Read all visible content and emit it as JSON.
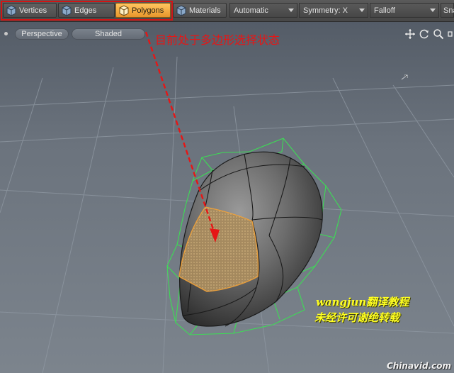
{
  "toolbar": {
    "modes": [
      {
        "label": "Vertices",
        "active": false
      },
      {
        "label": "Edges",
        "active": false
      },
      {
        "label": "Polygons",
        "active": true
      },
      {
        "label": "Materials",
        "active": false
      }
    ],
    "action_center": "Automatic",
    "symmetry": "Symmetry: X",
    "falloff": "Falloff",
    "snap": "Sna"
  },
  "viewport": {
    "view": "Perspective",
    "shading": "Shaded"
  },
  "annotations": {
    "red_note": "目前处于多边形选择状态",
    "credit_line1": "wangjun翻译教程",
    "credit_line2": "未经许可谢绝转载",
    "watermark": "Chinavid.com"
  },
  "colors": {
    "active_mode": "#f0a23a",
    "selection": "#f0a23a",
    "wireframe": "#3ddc55",
    "annotation_red": "#e61616",
    "credit_yellow": "#ffff22"
  }
}
